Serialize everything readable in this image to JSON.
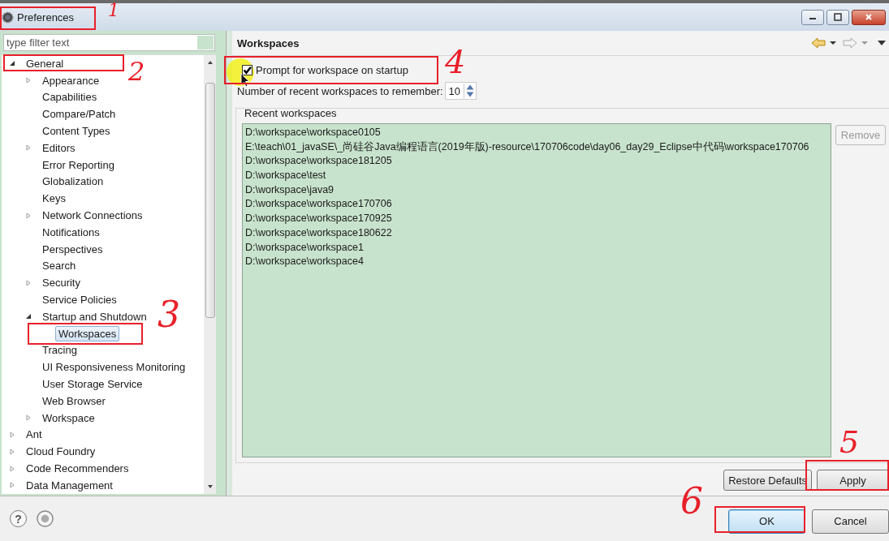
{
  "window": {
    "title": "Preferences"
  },
  "filter": {
    "placeholder": "type filter text"
  },
  "tree": [
    {
      "label": "General",
      "kind": "node",
      "expanded": true,
      "selected": false,
      "children": [
        {
          "label": "Appearance",
          "kind": "node",
          "expanded": false,
          "selected": false
        },
        {
          "label": "Capabilities",
          "kind": "leaf",
          "selected": false
        },
        {
          "label": "Compare/Patch",
          "kind": "leaf",
          "selected": false
        },
        {
          "label": "Content Types",
          "kind": "leaf",
          "selected": false
        },
        {
          "label": "Editors",
          "kind": "node",
          "expanded": false,
          "selected": false
        },
        {
          "label": "Error Reporting",
          "kind": "leaf",
          "selected": false
        },
        {
          "label": "Globalization",
          "kind": "leaf",
          "selected": false
        },
        {
          "label": "Keys",
          "kind": "leaf",
          "selected": false
        },
        {
          "label": "Network Connections",
          "kind": "node",
          "expanded": false,
          "selected": false
        },
        {
          "label": "Notifications",
          "kind": "leaf",
          "selected": false
        },
        {
          "label": "Perspectives",
          "kind": "leaf",
          "selected": false
        },
        {
          "label": "Search",
          "kind": "leaf",
          "selected": false
        },
        {
          "label": "Security",
          "kind": "node",
          "expanded": false,
          "selected": false
        },
        {
          "label": "Service Policies",
          "kind": "leaf",
          "selected": false
        },
        {
          "label": "Startup and Shutdown",
          "kind": "node",
          "expanded": true,
          "selected": false,
          "children": [
            {
              "label": "Workspaces",
              "kind": "leaf",
              "selected": true
            }
          ]
        },
        {
          "label": "Tracing",
          "kind": "leaf",
          "selected": false
        },
        {
          "label": "UI Responsiveness Monitoring",
          "kind": "leaf",
          "selected": false
        },
        {
          "label": "User Storage Service",
          "kind": "leaf",
          "selected": false
        },
        {
          "label": "Web Browser",
          "kind": "leaf",
          "selected": false
        },
        {
          "label": "Workspace",
          "kind": "node",
          "expanded": false,
          "selected": false
        }
      ]
    },
    {
      "label": "Ant",
      "kind": "node",
      "expanded": false,
      "selected": false
    },
    {
      "label": "Cloud Foundry",
      "kind": "node",
      "expanded": false,
      "selected": false
    },
    {
      "label": "Code Recommenders",
      "kind": "node",
      "expanded": false,
      "selected": false
    },
    {
      "label": "Data Management",
      "kind": "node",
      "expanded": false,
      "selected": false
    }
  ],
  "page": {
    "title": "Workspaces",
    "prompt": {
      "label": "Prompt for workspace on startup",
      "checked": true
    },
    "recent_count": {
      "label": "Number of recent workspaces to remember:",
      "value": "10"
    },
    "group_title": "Recent workspaces",
    "workspaces": [
      "D:\\workspace\\workspace0105",
      "E:\\teach\\01_javaSE\\_尚硅谷Java编程语言(2019年版)-resource\\170706code\\day06_day29_Eclipse中代码\\workspace170706",
      "D:\\workspace\\workspace181205",
      "D:\\workspace\\test",
      "D:\\workspace\\java9",
      "D:\\workspace\\workspace170706",
      "D:\\workspace\\workspace170925",
      "D:\\workspace\\workspace180622",
      "D:\\workspace\\workspace1",
      "D:\\workspace\\workspace4"
    ],
    "remove": {
      "label": "Remove",
      "disabled": true
    },
    "buttons": [
      {
        "label": "Restore Defaults"
      },
      {
        "label": "Apply"
      }
    ]
  },
  "help": "?",
  "dialog_buttons": [
    {
      "label": "OK",
      "default": true
    },
    {
      "label": "Cancel",
      "default": false
    }
  ],
  "annotations": [
    "1",
    "2",
    "3",
    "4",
    "5",
    "6"
  ]
}
